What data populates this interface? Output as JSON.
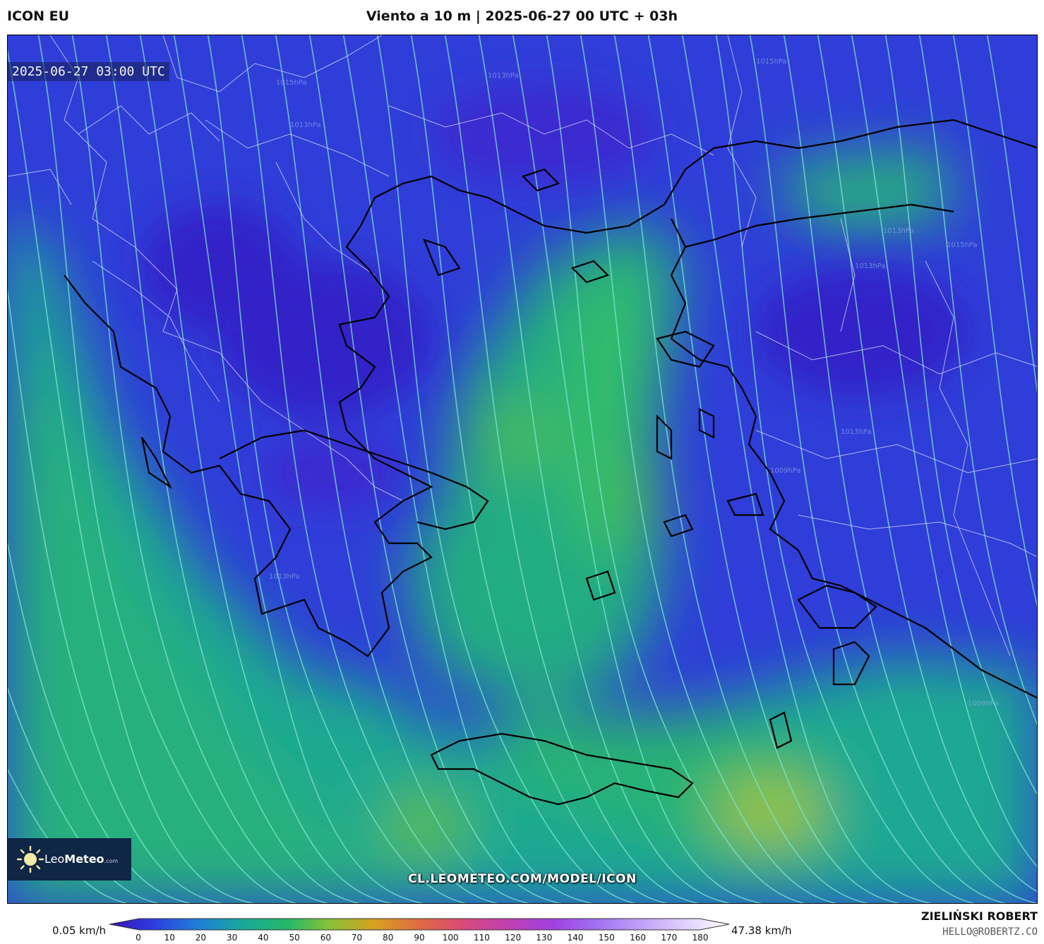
{
  "header": {
    "model": "ICON EU",
    "title": "Viento a 10 m | 2025-06-27 00 UTC + 03h"
  },
  "map": {
    "valid_time": "2025-06-27 03:00 UTC",
    "variable": "10 m wind speed with streamlines",
    "isobar_labels": [
      "1015hPa",
      "1013hPa",
      "1013hPa",
      "1013hPa",
      "1015hPa",
      "1013hPa",
      "1013hPa",
      "1009hPa",
      "1009hPa",
      "1013hPa",
      "1015hPa"
    ],
    "watermark": "CL.LEOMETEO.COM/MODEL/ICON",
    "colors": {
      "calm": "#3a2fd0",
      "light": "#2f5de0",
      "moderate": "#22a690",
      "fresh": "#2ec070",
      "strong": "#9ccf3a",
      "land_border": "#000000",
      "admin_border": "#c8c8d8"
    }
  },
  "logo": {
    "name_light": "Leo",
    "name_bold": "Meteo",
    "suffix": ".com",
    "icon": "sun-icon"
  },
  "colorbar": {
    "min_label": "0.05 km/h",
    "max_label": "47.38 km/h",
    "ticks": [
      "0",
      "10",
      "20",
      "30",
      "40",
      "50",
      "60",
      "70",
      "80",
      "90",
      "100",
      "110",
      "120",
      "130",
      "140",
      "150",
      "160",
      "170",
      "180"
    ],
    "stops": [
      "#3b0fb8",
      "#2d3de0",
      "#1f7ed8",
      "#1aa89a",
      "#22b86a",
      "#8bc036",
      "#d6a020",
      "#e06a40",
      "#d84a7a",
      "#c040b0",
      "#a040e0",
      "#a070f0",
      "#c0a0f8",
      "#e0d0fa",
      "#ffffff"
    ]
  },
  "credits": {
    "author": "ZIELIŃSKI ROBERT",
    "email": "HELLO@ROBERTZ.CO"
  }
}
